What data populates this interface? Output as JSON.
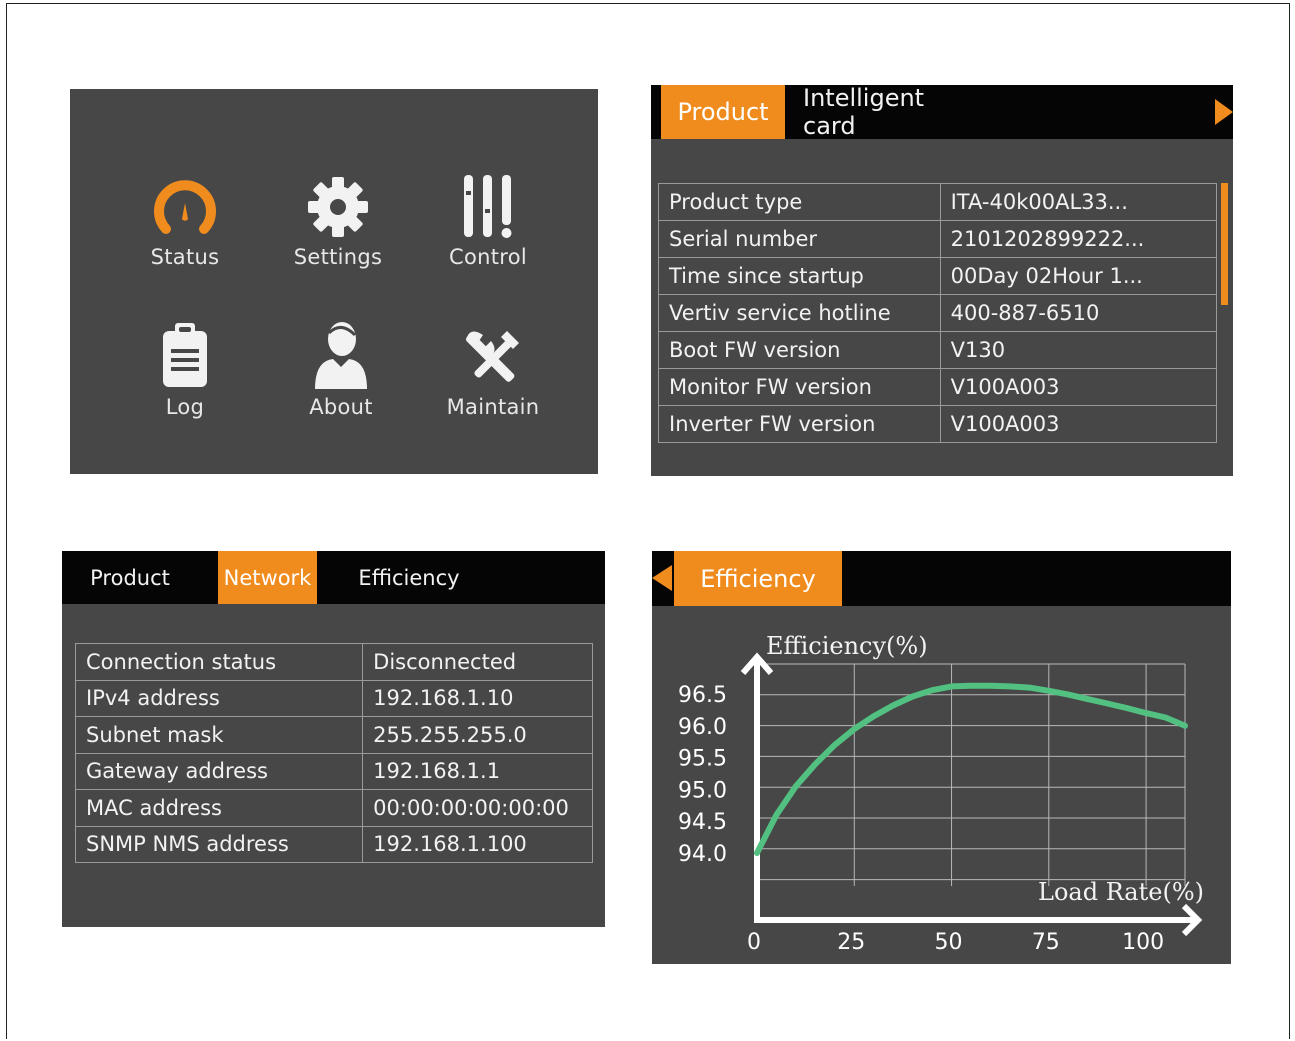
{
  "menu": {
    "items": [
      {
        "label": "Status",
        "icon": "gauge-icon"
      },
      {
        "label": "Settings",
        "icon": "gear-icon"
      },
      {
        "label": "Control",
        "icon": "sliders-icon"
      },
      {
        "label": "Log",
        "icon": "clipboard-icon"
      },
      {
        "label": "About",
        "icon": "user-icon"
      },
      {
        "label": "Maintain",
        "icon": "tools-icon"
      }
    ]
  },
  "product_panel": {
    "tabs": [
      "Product",
      "Intelligent card"
    ],
    "active_tab": "Product",
    "rows": [
      {
        "label": "Product type",
        "value": "ITA-40k00AL33..."
      },
      {
        "label": "Serial number",
        "value": "2101202899222..."
      },
      {
        "label": "Time since startup",
        "value": "00Day 02Hour 1..."
      },
      {
        "label": "Vertiv service hotline",
        "value": "400-887-6510"
      },
      {
        "label": "Boot FW version",
        "value": "V130"
      },
      {
        "label": "Monitor FW version",
        "value": "V100A003"
      },
      {
        "label": "Inverter FW version",
        "value": "V100A003"
      }
    ]
  },
  "network_panel": {
    "tabs": [
      "Product",
      "Network",
      "Efficiency"
    ],
    "active_tab": "Network",
    "rows": [
      {
        "label": "Connection status",
        "value": "Disconnected"
      },
      {
        "label": "IPv4 address",
        "value": "192.168.1.10"
      },
      {
        "label": "Subnet mask",
        "value": "255.255.255.0"
      },
      {
        "label": "Gateway address",
        "value": "192.168.1.1"
      },
      {
        "label": "MAC address",
        "value": "00:00:00:00:00:00"
      },
      {
        "label": "SNMP NMS address",
        "value": "192.168.1.100"
      }
    ]
  },
  "efficiency_panel": {
    "tab": "Efficiency"
  },
  "colors": {
    "accent": "#f08c1e",
    "panel_bg": "#474747",
    "tabbar_bg": "#050505",
    "curve": "#52c080"
  },
  "chart_data": {
    "type": "line",
    "xlabel": "Load Rate(%)",
    "ylabel": "Efficiency(%)",
    "x_ticks": [
      "0",
      "25",
      "50",
      "75",
      "100"
    ],
    "y_ticks": [
      "94.0",
      "94.5",
      "95.0",
      "95.5",
      "96.0",
      "96.5"
    ],
    "xlim": [
      0,
      110
    ],
    "ylim": [
      94.0,
      96.5
    ],
    "grid": true,
    "series": [
      {
        "x": [
          0,
          5,
          10,
          15,
          20,
          25,
          30,
          35,
          40,
          45,
          50,
          55,
          60,
          65,
          70,
          75,
          80,
          85,
          90,
          95,
          100,
          105,
          110
        ],
        "y": [
          94.0,
          94.6,
          95.05,
          95.4,
          95.7,
          95.95,
          96.15,
          96.32,
          96.46,
          96.56,
          96.62,
          96.63,
          96.63,
          96.62,
          96.6,
          96.55,
          96.49,
          96.42,
          96.35,
          96.28,
          96.2,
          96.13,
          96.0
        ]
      }
    ]
  }
}
